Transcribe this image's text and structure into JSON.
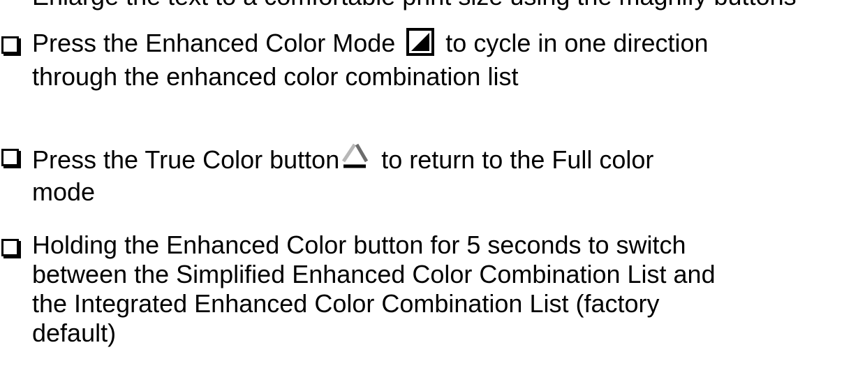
{
  "top_partial_line": "Enlarge the text to a comfortable print size using the magnify buttons",
  "items": [
    {
      "before_icon": "Press the Enhanced Color Mode",
      "icon": "enhanced-color-mode-icon",
      "after_icon": "to cycle in one direction",
      "continuation": "through the enhanced color combination list"
    },
    {
      "before_icon": "Press the True Color button",
      "icon": "true-color-icon",
      "after_icon": "to return to the Full color",
      "continuation": "mode"
    },
    {
      "line1": "Holding the Enhanced Color button for 5 seconds to switch",
      "line2": "between the Simplified Enhanced Color Combination List and",
      "line3": "the Integrated Enhanced Color Combination List (factory",
      "line4": "default)"
    }
  ]
}
